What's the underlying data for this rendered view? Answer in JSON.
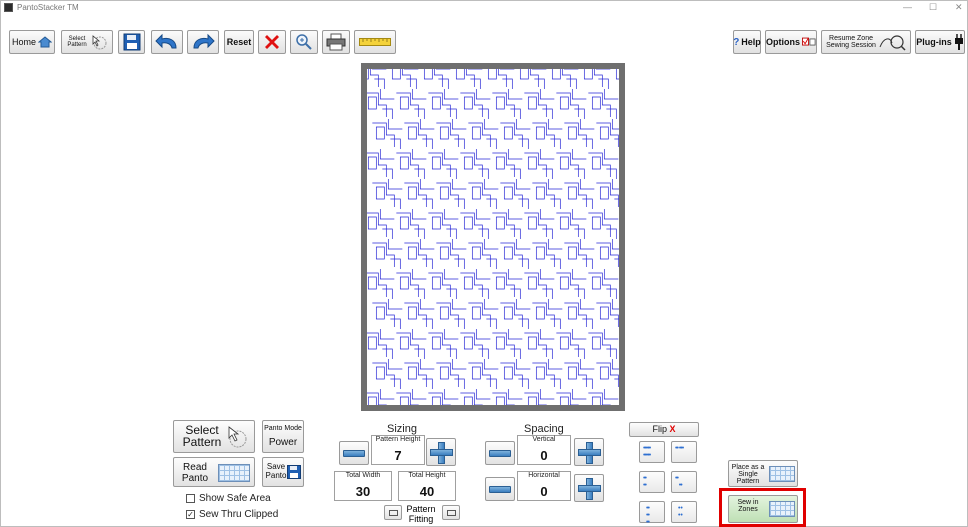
{
  "window": {
    "title": "PantoStacker TM",
    "minimize": "—",
    "maximize": "☐",
    "close": "✕"
  },
  "toolbar": {
    "home_label": "Home",
    "select_pattern_label": "Select Pattern",
    "reset_label": "Reset",
    "help_label": "Help",
    "options_label": "Options",
    "resume_label": "Resume Zone Sewing Session",
    "plugins_label": "Plug-ins"
  },
  "controls": {
    "select_pattern": "Select Pattern",
    "panto_mode_caption": "Panto Mode",
    "panto_mode_value": "Power",
    "read_panto": "Read Panto",
    "save_panto": "Save Panto",
    "show_safe_area": "Show Safe Area",
    "sew_thru_clipped": "Sew Thru Clipped",
    "show_safe_area_checked": false,
    "sew_thru_clipped_checked": true,
    "checked_mark": "✓"
  },
  "sizing": {
    "header": "Sizing",
    "pattern_height_label": "Pattern Height",
    "pattern_height": "7",
    "total_width_label": "Total Width",
    "total_width": "30",
    "total_height_label": "Total Height",
    "total_height": "40",
    "pattern_fitting": "Pattern Fitting"
  },
  "spacing": {
    "header": "Spacing",
    "vertical_label": "Vertical",
    "vertical": "0",
    "horizontal_label": "Horizontal",
    "horizontal": "0"
  },
  "flip": {
    "label": "Flip",
    "mark": "X"
  },
  "placement": {
    "single_label": "Place as a Single Pattern",
    "zones_label": "Sew in Zones"
  },
  "colors": {
    "pattern_line": "#2a2ad6",
    "highlight": "#e00000",
    "zones_bg": "#cfe8c8"
  }
}
